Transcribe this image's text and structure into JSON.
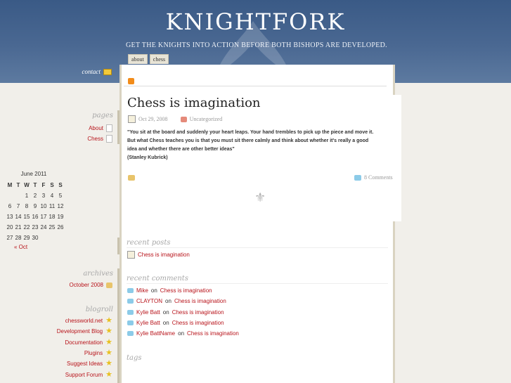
{
  "site": {
    "title": "KNIGHTFORK",
    "tagline": "GET THE KNIGHTS INTO ACTION BEFORE BOTH BISHOPS ARE DEVELOPED."
  },
  "tabs": [
    "about",
    "chess"
  ],
  "contact": "contact",
  "post": {
    "title": "Chess is imagination",
    "date": "Oct 29, 2008",
    "category": "Uncategorized",
    "quote_line1": "\"You sit at the board and suddenly your heart leaps. Your hand trembles to pick up the piece and move it.",
    "quote_line2": " But what Chess teaches you is that you must sit there calmly and think about whether it's really a good",
    "quote_line3": "idea and whether there are other better ideas\"",
    "author": "(Stanley Kubrick)",
    "comments": "8 Comments"
  },
  "sidebar": {
    "pages_heading": "pages",
    "pages": [
      "About",
      "Chess"
    ],
    "calendar": {
      "caption": "June 2011",
      "headers": [
        "M",
        "T",
        "W",
        "T",
        "F",
        "S",
        "S"
      ],
      "rows": [
        [
          "",
          "",
          "1",
          "2",
          "3",
          "4",
          "5"
        ],
        [
          "6",
          "7",
          "8",
          "9",
          "10",
          "11",
          "12"
        ],
        [
          "13",
          "14",
          "15",
          "16",
          "17",
          "18",
          "19"
        ],
        [
          "20",
          "21",
          "22",
          "23",
          "24",
          "25",
          "26"
        ],
        [
          "27",
          "28",
          "29",
          "30",
          "",
          "",
          ""
        ]
      ],
      "prev": "« Oct"
    },
    "archives_heading": "archives",
    "archives": [
      "October 2008"
    ],
    "blogroll_heading": "blogroll",
    "blogroll": [
      "chessworld.net",
      "Development Blog",
      "Documentation",
      "Plugins",
      "Suggest Ideas",
      "Support Forum"
    ]
  },
  "recent_posts": {
    "heading": "recent posts",
    "items": [
      "Chess is imagination"
    ]
  },
  "recent_comments": {
    "heading": "recent comments",
    "on": "on",
    "items": [
      {
        "author": "Mike",
        "post": "Chess is imagination"
      },
      {
        "author": "CLAYTON",
        "post": "Chess is imagination"
      },
      {
        "author": "Kylie Batt",
        "post": "Chess is imagination"
      },
      {
        "author": "Kylie Batt",
        "post": "Chess is imagination"
      },
      {
        "author": "Kylie BattName",
        "post": "Chess is imagination"
      }
    ]
  },
  "tags_heading": "tags"
}
